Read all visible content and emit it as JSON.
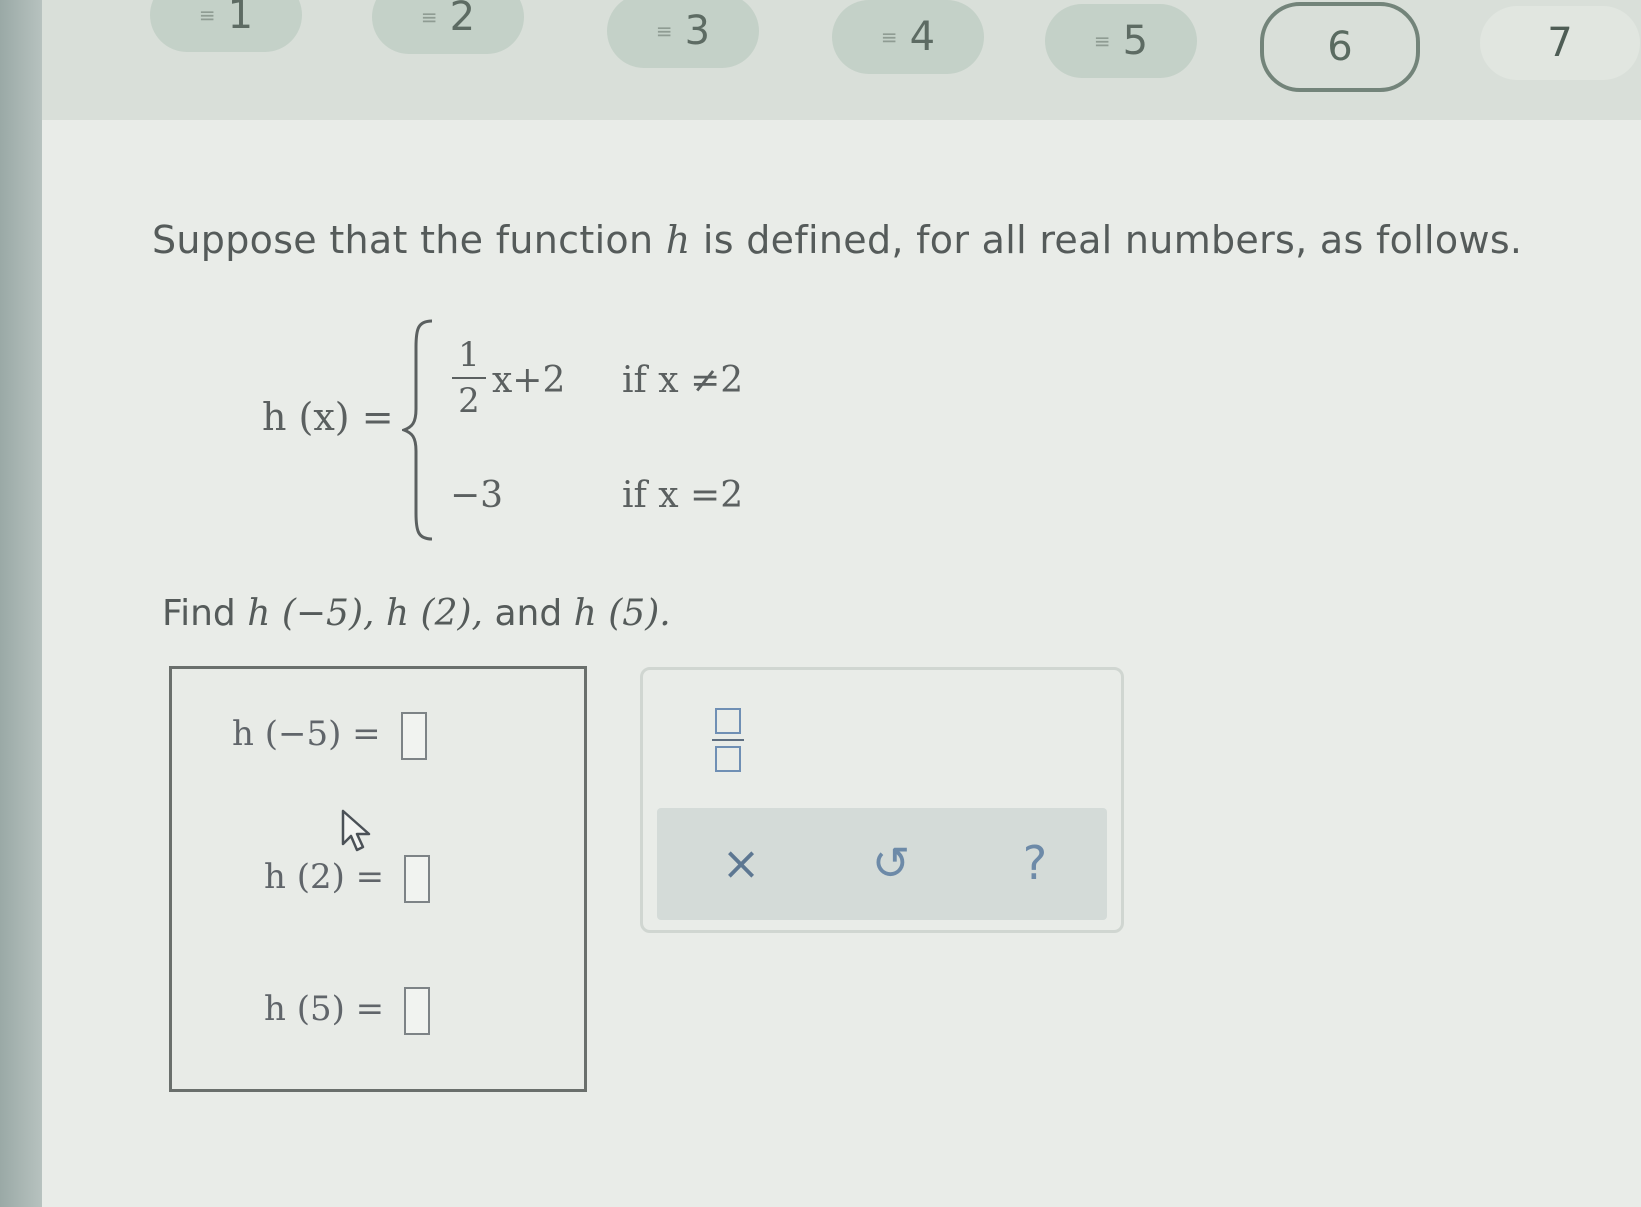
{
  "nav": {
    "questions": [
      {
        "label": "1",
        "state": "answered"
      },
      {
        "label": "2",
        "state": "answered"
      },
      {
        "label": "3",
        "state": "answered"
      },
      {
        "label": "4",
        "state": "answered"
      },
      {
        "label": "5",
        "state": "answered"
      },
      {
        "label": "6",
        "state": "current"
      },
      {
        "label": "7",
        "state": "unanswered"
      }
    ],
    "answered_icon": "lines-icon"
  },
  "question": {
    "prompt_before": "Suppose that the function ",
    "prompt_var": "h",
    "prompt_after": " is defined, for all real numbers, as follows.",
    "function": {
      "lhs": "h (x) =",
      "case1_fraction_num": "1",
      "case1_fraction_den": "2",
      "case1_expr": "x+2",
      "case1_condition": "if x ≠2",
      "case2_value": "−3",
      "case2_condition": "if x =2"
    },
    "find_label": "Find",
    "find_h1": "h (−5),",
    "find_h2": "h (2),",
    "find_and": "and",
    "find_h3": "h (5)."
  },
  "answers": [
    {
      "label": "h (−5) =",
      "value": ""
    },
    {
      "label": "h (2) =",
      "value": ""
    },
    {
      "label": "h (5) =",
      "value": ""
    }
  ],
  "palette": {
    "fraction_icon": "fraction-icon",
    "clear_symbol": "×",
    "undo_symbol": "↺",
    "help_symbol": "?"
  }
}
